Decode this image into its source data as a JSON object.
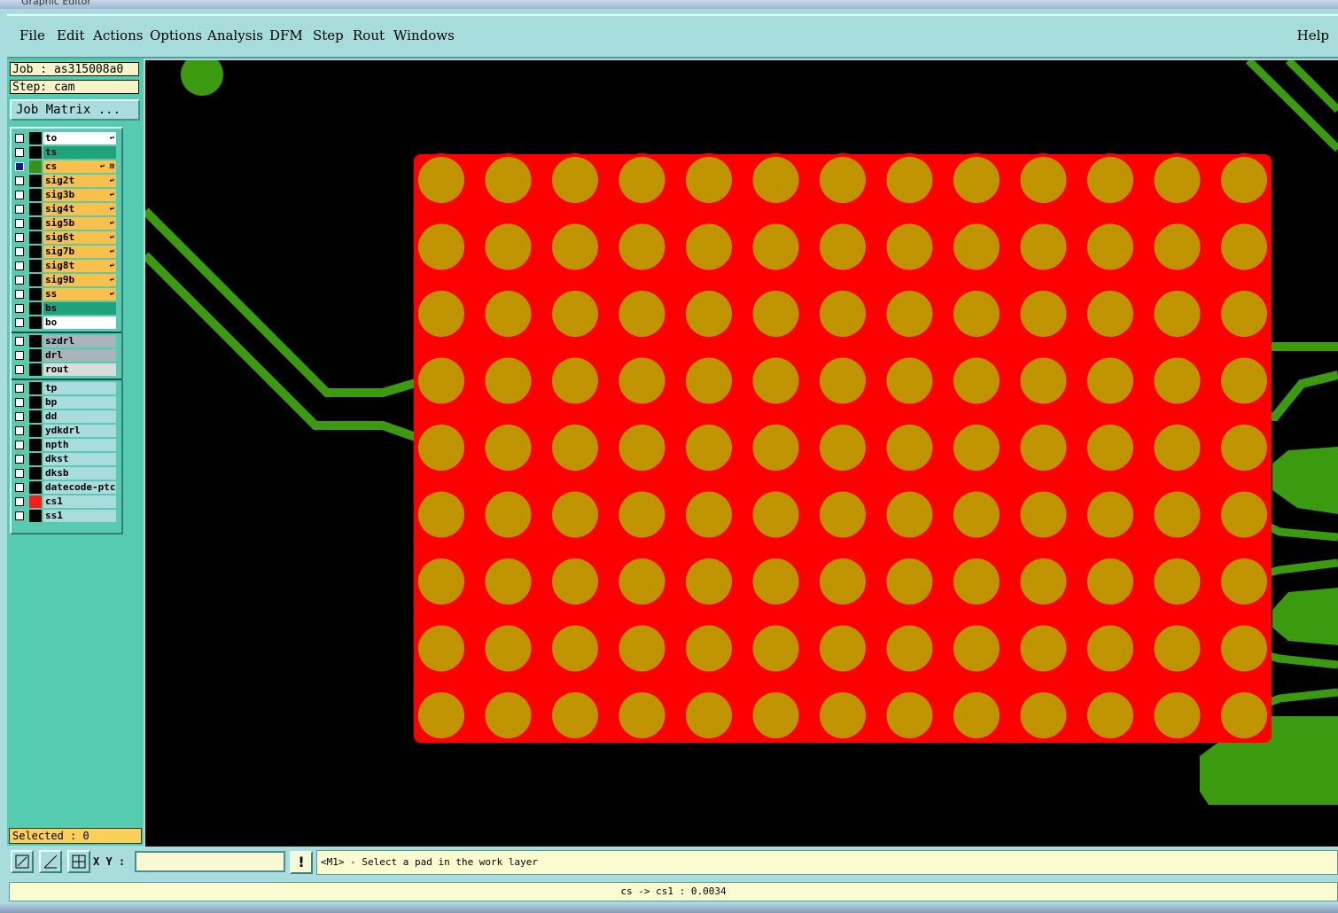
{
  "window": {
    "title": "Graphic Editor"
  },
  "menubar": {
    "items": [
      "File",
      "Edit",
      "Actions",
      "Options",
      "Analysis",
      "DFM",
      "Step",
      "Rout",
      "Windows"
    ],
    "help": "Help"
  },
  "job_info": {
    "job": "Job : as315008a0",
    "step": "Step: cam",
    "job_matrix_button": "Job Matrix ..."
  },
  "layers": {
    "board": [
      {
        "name": "to",
        "color": "#ffffff",
        "box": "#000000",
        "flag": "↩"
      },
      {
        "name": "ts",
        "color": "#1fa17a",
        "box": "#000000",
        "flag": ""
      },
      {
        "name": "cs",
        "color": "#f9c14c",
        "box": "#3b8f1c",
        "flag": "↩ ⊞",
        "selected": true
      },
      {
        "name": "sig2t",
        "color": "#f9c14c",
        "box": "#000000",
        "flag": "↩"
      },
      {
        "name": "sig3b",
        "color": "#f9c14c",
        "box": "#000000",
        "flag": "↩"
      },
      {
        "name": "sig4t",
        "color": "#f9c14c",
        "box": "#000000",
        "flag": "↩"
      },
      {
        "name": "sig5b",
        "color": "#f9c14c",
        "box": "#000000",
        "flag": "↩"
      },
      {
        "name": "sig6t",
        "color": "#f9c14c",
        "box": "#000000",
        "flag": "↩"
      },
      {
        "name": "sig7b",
        "color": "#f9c14c",
        "box": "#000000",
        "flag": "↩"
      },
      {
        "name": "sig8t",
        "color": "#f9c14c",
        "box": "#000000",
        "flag": "↩"
      },
      {
        "name": "sig9b",
        "color": "#f9c14c",
        "box": "#000000",
        "flag": "↩"
      },
      {
        "name": "ss",
        "color": "#f9c14c",
        "box": "#000000",
        "flag": "↩"
      },
      {
        "name": "bs",
        "color": "#1fa17a",
        "box": "#000000",
        "flag": ""
      },
      {
        "name": "bo",
        "color": "#ffffff",
        "box": "#000000",
        "flag": ""
      }
    ],
    "drill": [
      {
        "name": "szdrl",
        "color": "#a7b5ba",
        "box": "#000000",
        "flag": ""
      },
      {
        "name": "drl",
        "color": "#a7b5ba",
        "box": "#000000",
        "flag": ""
      },
      {
        "name": "rout",
        "color": "#d9dcdc",
        "box": "#000000",
        "flag": ""
      }
    ],
    "misc": [
      {
        "name": "tp",
        "color": "#a9dcdc",
        "box": "#000000",
        "flag": ""
      },
      {
        "name": "bp",
        "color": "#a9dcdc",
        "box": "#000000",
        "flag": ""
      },
      {
        "name": "dd",
        "color": "#a9dcdc",
        "box": "#000000",
        "flag": ""
      },
      {
        "name": "ydkdrl",
        "color": "#a9dcdc",
        "box": "#000000",
        "flag": ""
      },
      {
        "name": "npth",
        "color": "#a9dcdc",
        "box": "#000000",
        "flag": ""
      },
      {
        "name": "dkst",
        "color": "#a9dcdc",
        "box": "#000000",
        "flag": ""
      },
      {
        "name": "dksb",
        "color": "#a9dcdc",
        "box": "#000000",
        "flag": ""
      },
      {
        "name": "datecode-ptc",
        "color": "#a9dcdc",
        "box": "#000000",
        "flag": ""
      },
      {
        "name": "cs1",
        "color": "#a9dcdc",
        "box": "#ff1a1a",
        "flag": ""
      },
      {
        "name": "ss1",
        "color": "#a9dcdc",
        "box": "#000000",
        "flag": ""
      }
    ]
  },
  "selected": "Selected : 0",
  "toolbar": {
    "xy_label": "X Y :",
    "xy_value": "",
    "bang": "!",
    "prompt": "<M1> - Select a pad in the work layer"
  },
  "status": "cs -> cs1 : 0.0034",
  "canvas": {
    "colors": {
      "background": "#000000",
      "copper": "#ff0000",
      "pad": "#c09400",
      "trace": "#3c9a10"
    },
    "pad_grid": {
      "rows": 9,
      "cols": 13
    }
  }
}
